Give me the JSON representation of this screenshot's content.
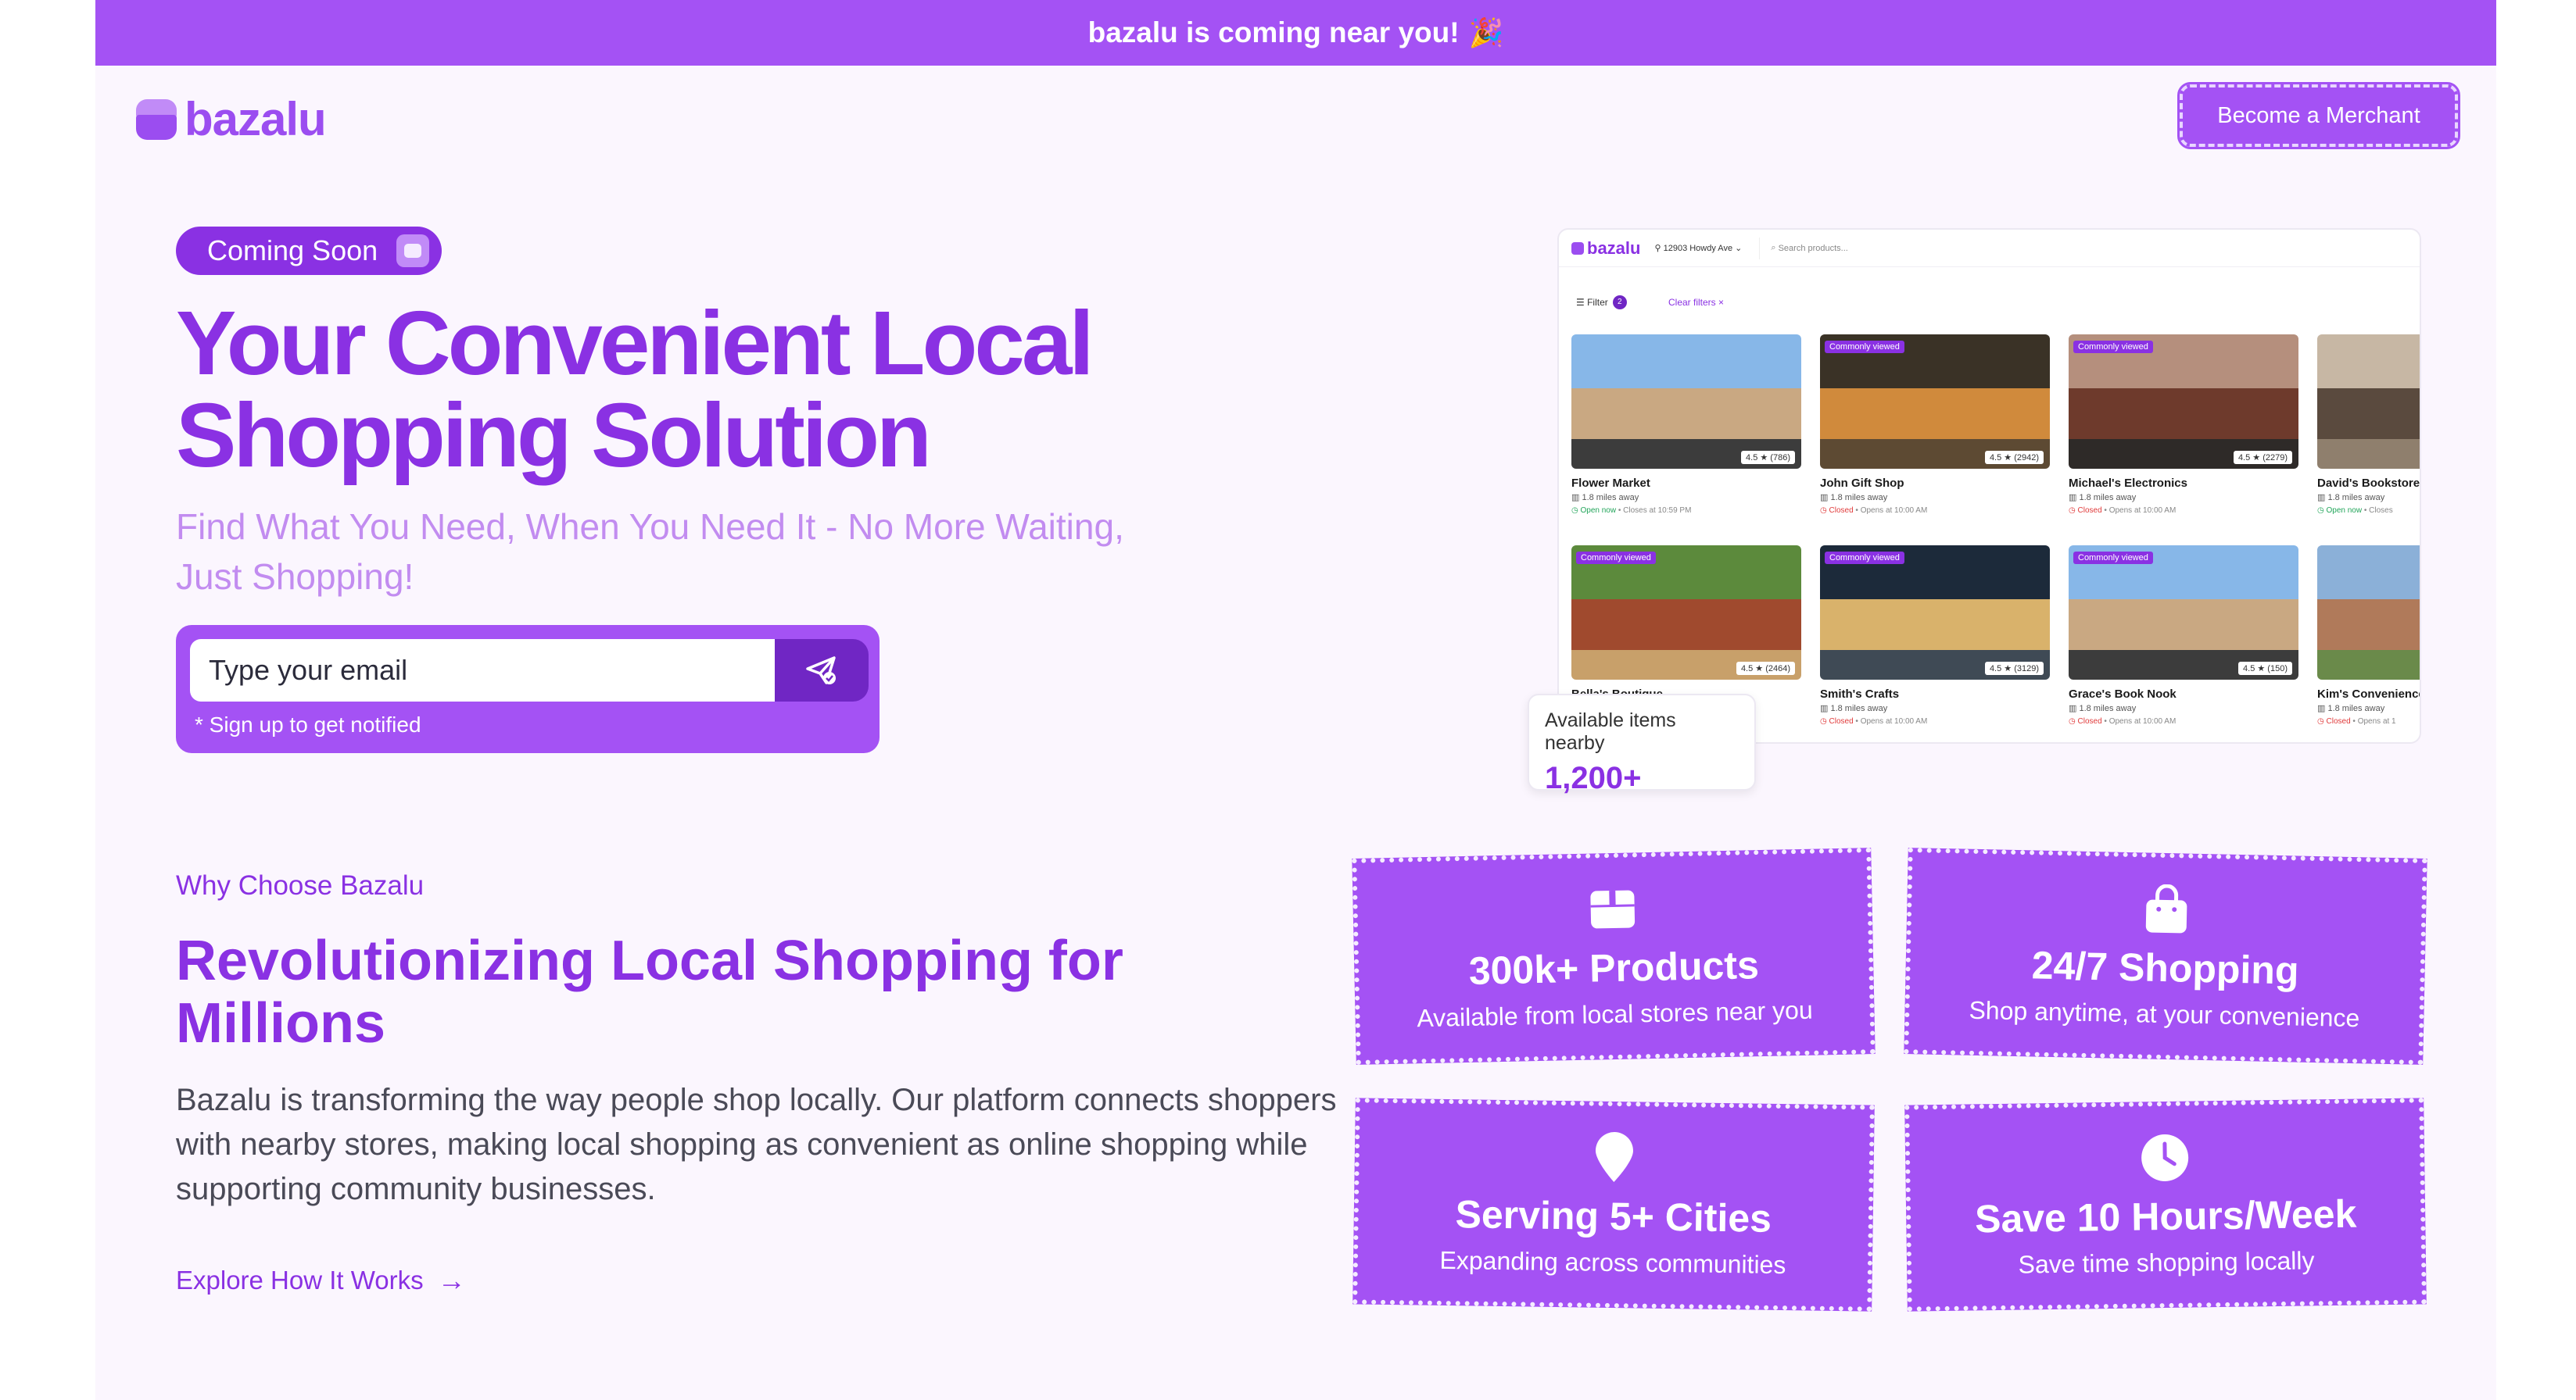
{
  "announcement": {
    "text": "bazalu is coming near you!",
    "emoji": "🎉"
  },
  "header": {
    "logo_text": "bazalu",
    "merchant_button": "Become a Merchant"
  },
  "hero": {
    "badge": "Coming Soon",
    "title_line1": "Your Convenient Local",
    "title_line2": "Shopping Solution",
    "subtitle": "Find What You Need, When You Need It - No More Waiting, Just Shopping!",
    "email_placeholder": "Type your email",
    "signup_note": "* Sign up to get notified"
  },
  "mock": {
    "logo": "bazalu",
    "location": "12903 Howdy Ave",
    "search_placeholder": "Search products...",
    "filter_label": "Filter",
    "filter_count": "2",
    "clear_filters": "Clear filters ×",
    "cards": [
      {
        "name": "Flower Market",
        "distance": "1.8 miles away",
        "status": "Open now",
        "status_type": "open",
        "hours": "• Closes at 10:59 PM",
        "rating": "4.5 ★ (786)",
        "badge": ""
      },
      {
        "name": "John Gift Shop",
        "distance": "1.8 miles away",
        "status": "Closed",
        "status_type": "closed",
        "hours": "• Opens at 10:00 AM",
        "rating": "4.5 ★ (2942)",
        "badge": "Commonly viewed"
      },
      {
        "name": "Michael's Electronics",
        "distance": "1.8 miles away",
        "status": "Closed",
        "status_type": "closed",
        "hours": "• Opens at 10:00 AM",
        "rating": "4.5 ★ (2279)",
        "badge": "Commonly viewed"
      },
      {
        "name": "David's Bookstore",
        "distance": "1.8 miles away",
        "status": "Open now",
        "status_type": "open",
        "hours": "• Closes",
        "rating": "",
        "badge": ""
      },
      {
        "name": "Bella's Boutique",
        "distance": "",
        "status": "",
        "status_type": "",
        "hours": "",
        "rating": "4.5 ★ (2464)",
        "badge": "Commonly viewed"
      },
      {
        "name": "Smith's Crafts",
        "distance": "1.8 miles away",
        "status": "Closed",
        "status_type": "closed",
        "hours": "• Opens at 10:00 AM",
        "rating": "4.5 ★ (3129)",
        "badge": "Commonly viewed"
      },
      {
        "name": "Grace's Book Nook",
        "distance": "1.8 miles away",
        "status": "Closed",
        "status_type": "closed",
        "hours": "• Opens at 10:00 AM",
        "rating": "4.5 ★ (150)",
        "badge": "Commonly viewed"
      },
      {
        "name": "Kim's Convenience",
        "distance": "1.8 miles away",
        "status": "Closed",
        "status_type": "closed",
        "hours": "• Opens at 1",
        "rating": "",
        "badge": ""
      }
    ]
  },
  "available": {
    "label": "Available items nearby",
    "value": "1,200+"
  },
  "why": {
    "label": "Why Choose Bazalu",
    "title": "Revolutionizing Local Shopping for Millions",
    "body": "Bazalu is transforming the way people shop locally. Our platform connects shoppers with nearby stores, making local shopping as convenient as online shopping while supporting community businesses.",
    "link": "Explore How It Works"
  },
  "stats": [
    {
      "icon": "box-icon",
      "title": "300k+ Products",
      "desc": "Available from local stores near you"
    },
    {
      "icon": "shopping-bag-icon",
      "title": "24/7 Shopping",
      "desc": "Shop anytime, at your convenience"
    },
    {
      "icon": "map-pin-icon",
      "title": "Serving 5+ Cities",
      "desc": "Expanding across communities"
    },
    {
      "icon": "clock-icon",
      "title": "Save 10 Hours/Week",
      "desc": "Save time shopping locally"
    }
  ],
  "colors": {
    "primary": "#a452f4",
    "deep": "#8a31e3",
    "background": "#fbf6fe"
  }
}
